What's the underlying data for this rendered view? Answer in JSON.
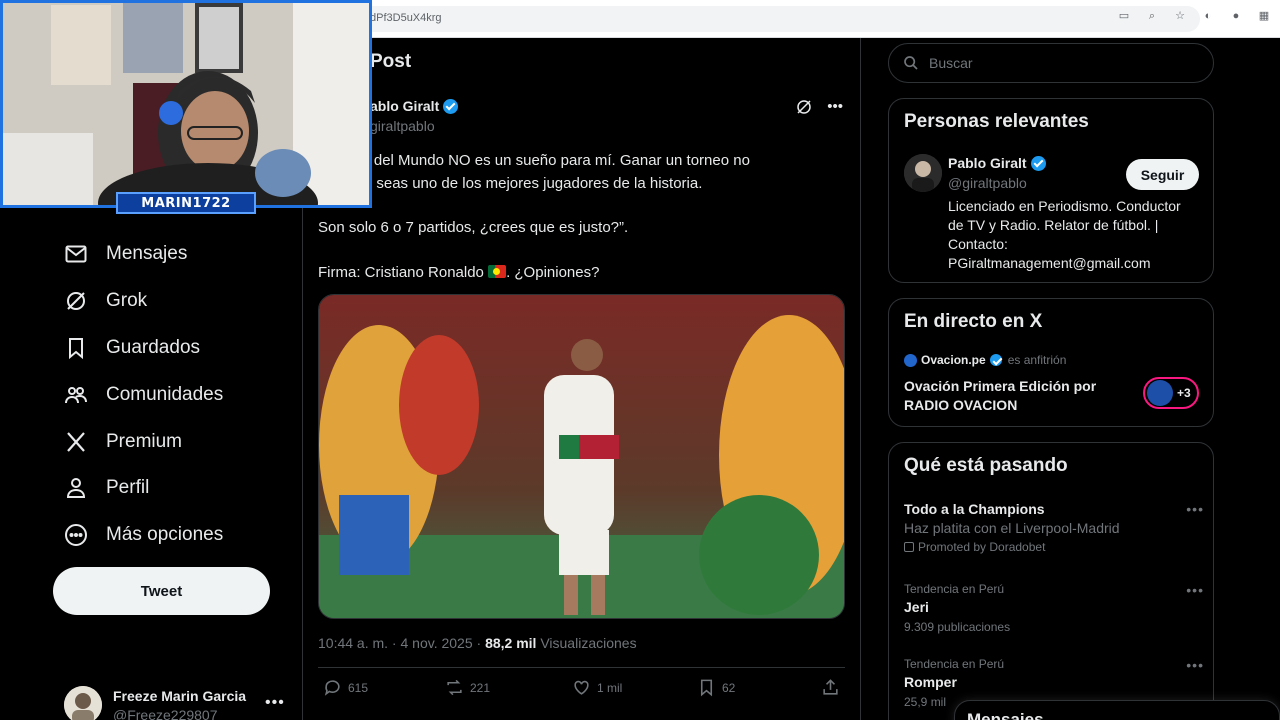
{
  "browser": {
    "url_fragment": "dPf3D5uX4krg"
  },
  "nav": {
    "items": [
      {
        "label": "Mensajes",
        "icon": "envelope-icon"
      },
      {
        "label": "Grok",
        "icon": "grok-icon"
      },
      {
        "label": "Guardados",
        "icon": "bookmark-icon"
      },
      {
        "label": "Comunidades",
        "icon": "communities-icon"
      },
      {
        "label": "Premium",
        "icon": "x-logo-icon"
      },
      {
        "label": "Perfil",
        "icon": "person-icon"
      },
      {
        "label": "Más opciones",
        "icon": "more-circle-icon"
      }
    ],
    "tweet_button": "Tweet",
    "account": {
      "name": "Freeze Marin Garcia",
      "handle": "@Freeze229807"
    }
  },
  "post": {
    "header_title": "Post",
    "author_name": "ablo Giralt",
    "author_handle": "giraltpablo",
    "text_line1": "la Copa del Mundo NO es un sueño para mí. Ganar un torneo no",
    "text_line2": "stra que seas uno de los mejores jugadores de la historia.",
    "text_line3": "Son solo 6 o 7 partidos, ¿crees que es justo?”.",
    "text_line4_before": "Firma: Cristiano Ronaldo ",
    "text_line4_after": ". ¿Opiniones?",
    "timestamp": "10:44 a. m. · 4 nov. 2025 · ",
    "views_count": "88,2 mil",
    "views_label": " Visualizaciones",
    "replies": "615",
    "reposts": "221",
    "likes": "1 mil",
    "bookmarks": "62"
  },
  "search": {
    "placeholder": "Buscar"
  },
  "relevant": {
    "title": "Personas relevantes",
    "name": "Pablo Giralt",
    "handle": "@giraltpablo",
    "follow_label": "Seguir",
    "bio": "Licenciado en Periodismo. Conductor de TV y Radio. Relator de fútbol. | Contacto: PGiraltmanagement@gmail.com"
  },
  "live": {
    "title": "En directo en X",
    "host_name": "Ovacion.pe",
    "host_role": "es anfitrión",
    "stream_title": "Ovación Primera Edición por RADIO OVACION",
    "extra_count": "+3"
  },
  "trending": {
    "title": "Qué está pasando",
    "items": [
      {
        "name": "Todo a la Champions",
        "sub": "Haz platita con el Liverpool-Madrid",
        "promo": "Promoted by Doradobet"
      },
      {
        "meta": "Tendencia en Perú",
        "name": "Jeri",
        "count": "9.309 publicaciones"
      },
      {
        "meta": "Tendencia en Perú",
        "name": "Romper",
        "count": "25,9 mil"
      }
    ]
  },
  "messages_drawer": {
    "label": "Mensajes"
  },
  "webcam": {
    "name_tag": "MARIN1722"
  },
  "colors": {
    "accent_blue": "#1d9bf0",
    "live_pink": "#f91880",
    "background": "#000000"
  }
}
